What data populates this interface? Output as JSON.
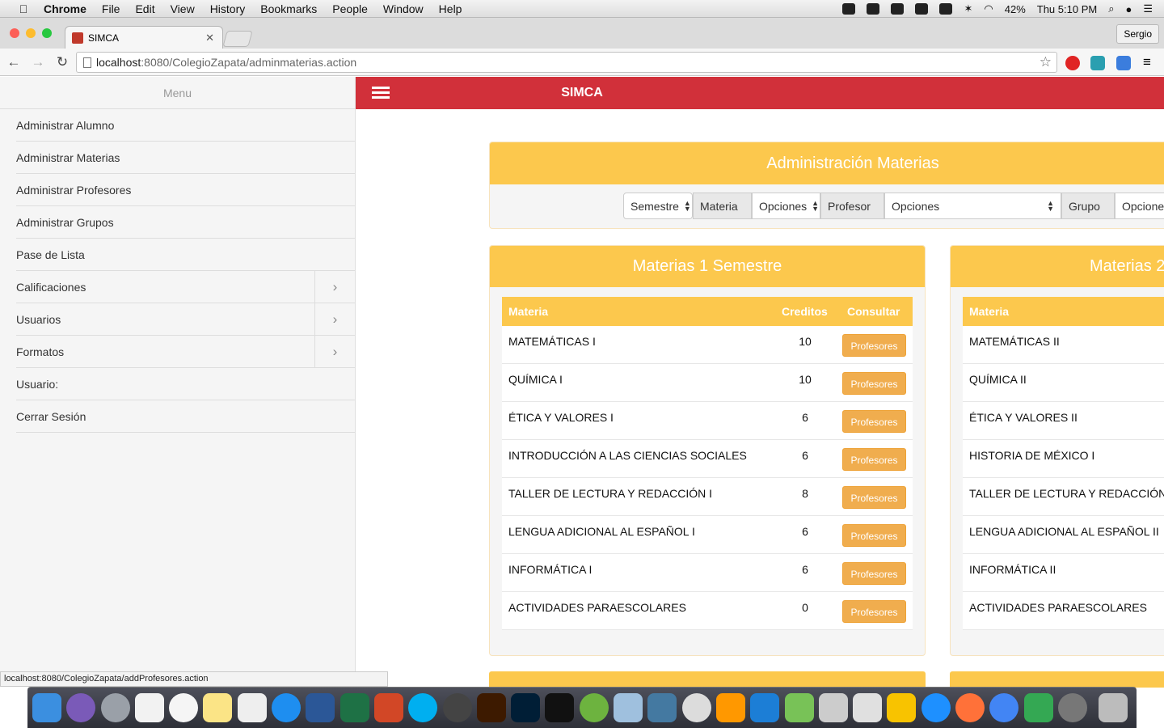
{
  "mac_menu": {
    "app": "Chrome",
    "items": [
      "File",
      "Edit",
      "View",
      "History",
      "Bookmarks",
      "People",
      "Window",
      "Help"
    ],
    "battery": "42%",
    "clock": "Thu 5:10 PM"
  },
  "browser": {
    "tab_title": "SIMCA",
    "profile": "Sergio",
    "url_host": "localhost",
    "url_rest": ":8080/ColegioZapata/adminmaterias.action",
    "status_url": "localhost:8080/ColegioZapata/addProfesores.action"
  },
  "sidebar": {
    "title": "Menu",
    "items": [
      {
        "label": "Administrar Alumno",
        "has_sub": false
      },
      {
        "label": "Administrar Materias",
        "has_sub": false
      },
      {
        "label": "Administrar Profesores",
        "has_sub": false
      },
      {
        "label": "Administrar Grupos",
        "has_sub": false
      },
      {
        "label": "Pase de Lista",
        "has_sub": false
      },
      {
        "label": "Calificaciones",
        "has_sub": true
      },
      {
        "label": "Usuarios",
        "has_sub": true
      },
      {
        "label": "Formatos",
        "has_sub": true
      },
      {
        "label": "Usuario:",
        "has_sub": false
      },
      {
        "label": "Cerrar Sesión",
        "has_sub": false
      }
    ]
  },
  "app": {
    "brand": "SIMCA",
    "admin_title": "Administración Materias"
  },
  "filters": {
    "semestre": "Semestre",
    "materia_addon": "Materia",
    "materia_opt": "Opciones",
    "profesor_addon": "Profesor",
    "profesor_opt": "Opciones",
    "grupo_addon": "Grupo",
    "grupo_opt": "Opcione"
  },
  "table_headers": {
    "materia": "Materia",
    "creditos": "Creditos",
    "consultar": "Consultar"
  },
  "panels": [
    {
      "title": "Materias 1 Semestre",
      "rows": [
        {
          "materia": "MATEMÁTICAS I",
          "creditos": "10",
          "button": "Profesores"
        },
        {
          "materia": "QUÍMICA I",
          "creditos": "10",
          "button": "Profesores"
        },
        {
          "materia": "ÉTICA Y VALORES I",
          "creditos": "6",
          "button": "Profesores"
        },
        {
          "materia": "INTRODUCCIÓN A LAS CIENCIAS SOCIALES",
          "creditos": "6",
          "button": "Profesores"
        },
        {
          "materia": "TALLER DE LECTURA Y REDACCIÓN I",
          "creditos": "8",
          "button": "Profesores"
        },
        {
          "materia": "LENGUA ADICIONAL AL ESPAÑOL I",
          "creditos": "6",
          "button": "Profesores"
        },
        {
          "materia": "INFORMÁTICA I",
          "creditos": "6",
          "button": "Profesores"
        },
        {
          "materia": "ACTIVIDADES PARAESCOLARES",
          "creditos": "0",
          "button": "Profesores"
        }
      ]
    },
    {
      "title": "Materias 2",
      "rows": [
        {
          "materia": "MATEMÁTICAS II"
        },
        {
          "materia": "QUÍMICA II"
        },
        {
          "materia": "ÉTICA Y VALORES II"
        },
        {
          "materia": "HISTORIA DE MÉXICO I"
        },
        {
          "materia": "TALLER DE LECTURA Y REDACCIÓN"
        },
        {
          "materia": "LENGUA ADICIONAL AL ESPAÑOL II"
        },
        {
          "materia": "INFORMÁTICA II"
        },
        {
          "materia": "ACTIVIDADES PARAESCOLARES"
        }
      ]
    }
  ],
  "colors": {
    "topbar": "#d1303a",
    "panel_header": "#fcc84d",
    "button": "#f0ad4e"
  }
}
